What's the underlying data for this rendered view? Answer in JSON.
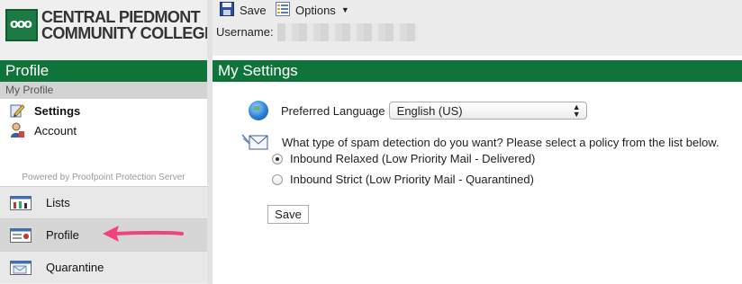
{
  "logo": {
    "mark": "ooo",
    "line1": "CENTRAL PIEDMONT",
    "line2": "COMMUNITY COLLEGE"
  },
  "toolbar": {
    "save_label": "Save",
    "options_label": "Options",
    "username_label": "Username:"
  },
  "sidebar": {
    "header": "Profile",
    "subheader": "My Profile",
    "items": [
      {
        "label": "Settings",
        "icon": "settings-pencil-icon"
      },
      {
        "label": "Account",
        "icon": "account-user-icon"
      }
    ],
    "powered_by": "Powered by Proofpoint Protection Server",
    "nav": [
      {
        "label": "Lists",
        "icon": "lists-icon"
      },
      {
        "label": "Profile",
        "icon": "profile-icon",
        "selected": true
      },
      {
        "label": "Quarantine",
        "icon": "quarantine-icon"
      }
    ]
  },
  "main": {
    "title": "My Settings",
    "language": {
      "label": "Preferred Language",
      "selected": "English (US)"
    },
    "spam": {
      "question": "What type of spam detection do you want? Please select a policy from the list below.",
      "options": [
        {
          "label": "Inbound Relaxed (Low Priority Mail - Delivered)",
          "checked": true
        },
        {
          "label": "Inbound Strict (Low Priority Mail - Quarantined)",
          "checked": false
        }
      ]
    },
    "save_label": "Save"
  },
  "colors": {
    "brand_green": "#0e7439",
    "annotation_arrow": "#f0437a"
  }
}
